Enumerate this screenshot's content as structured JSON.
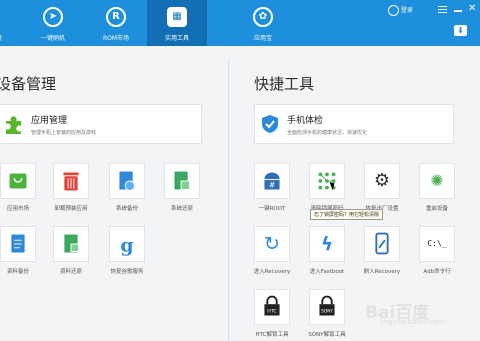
{
  "nav": {
    "items": [
      {
        "label": "度",
        "glyph": ""
      },
      {
        "label": "一键刷机",
        "glyph": "➤"
      },
      {
        "label": "ROM市场",
        "glyph": "R"
      },
      {
        "label": "实用工具",
        "glyph": "▦"
      },
      {
        "label": "应用宝",
        "glyph": "✿"
      }
    ],
    "login_label": "登录",
    "close_glyph": "✕",
    "download_glyph": "⬇"
  },
  "left_panel": {
    "title": "设备管理",
    "feature": {
      "title": "应用管理",
      "desc": "管理手机上安装的应用及游戏"
    },
    "tools": [
      {
        "label": "应用市场"
      },
      {
        "label": "卸载预装应用"
      },
      {
        "label": "系统备份"
      },
      {
        "label": "系统还原"
      },
      {
        "label": "资料备份"
      },
      {
        "label": "资料还原"
      },
      {
        "label": "恢复谷歌服务"
      }
    ]
  },
  "right_panel": {
    "title": "快捷工具",
    "feature": {
      "title": "手机体检",
      "desc": "全面检测手机的健康状况，快速优化"
    },
    "tools": [
      {
        "label": "一键ROOT",
        "glyph": "#"
      },
      {
        "label": "清除锁屏密码",
        "glyph": "⁘"
      },
      {
        "label": "恢复出厂设置",
        "glyph": "⚙"
      },
      {
        "label": "重启设备",
        "glyph": "✺"
      },
      {
        "label": "进入Recovery",
        "glyph": "↻"
      },
      {
        "label": "进入Fastboot",
        "glyph": "ϟ"
      },
      {
        "label": "刷入Recovery",
        "glyph": "✎"
      },
      {
        "label": "Adb命令行",
        "glyph": "C:\\_"
      },
      {
        "label": "HTC解锁工具",
        "glyph": "HTC"
      },
      {
        "label": "SONY解锁工具",
        "glyph": "SONY"
      }
    ],
    "tooltip": "忘了锁屏密码？用它轻松清除"
  },
  "watermark": {
    "text": "Bai百度",
    "url": "jingyan.baidu.com"
  }
}
